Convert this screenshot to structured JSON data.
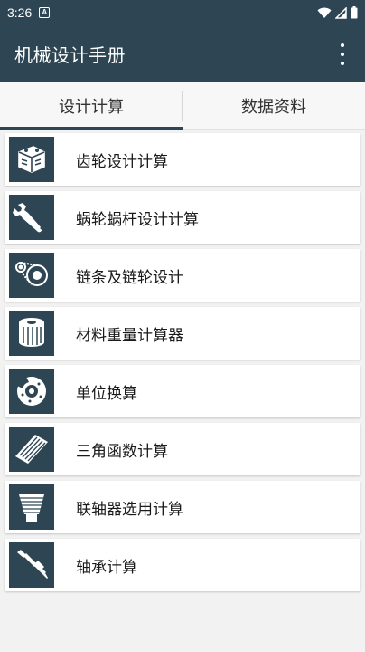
{
  "status_bar": {
    "time": "3:26",
    "notification_letter": "A"
  },
  "app": {
    "title": "机械设计手册"
  },
  "tabs": [
    {
      "label": "设计计算",
      "active": true
    },
    {
      "label": "数据资料",
      "active": false
    }
  ],
  "items": [
    {
      "label": "齿轮设计计算",
      "icon": "engine-icon"
    },
    {
      "label": "蜗轮蜗杆设计计算",
      "icon": "wrench-icon"
    },
    {
      "label": "链条及链轮设计",
      "icon": "chain-drive-icon"
    },
    {
      "label": "材料重量计算器",
      "icon": "filter-cylinder-icon"
    },
    {
      "label": "单位换算",
      "icon": "brake-disc-icon"
    },
    {
      "label": "三角函数计算",
      "icon": "air-filter-icon"
    },
    {
      "label": "联轴器选用计算",
      "icon": "cone-filter-icon"
    },
    {
      "label": "轴承计算",
      "icon": "spark-plug-icon"
    }
  ],
  "colors": {
    "primary": "#2e4654",
    "background": "#f2f2f2",
    "card": "#ffffff"
  }
}
